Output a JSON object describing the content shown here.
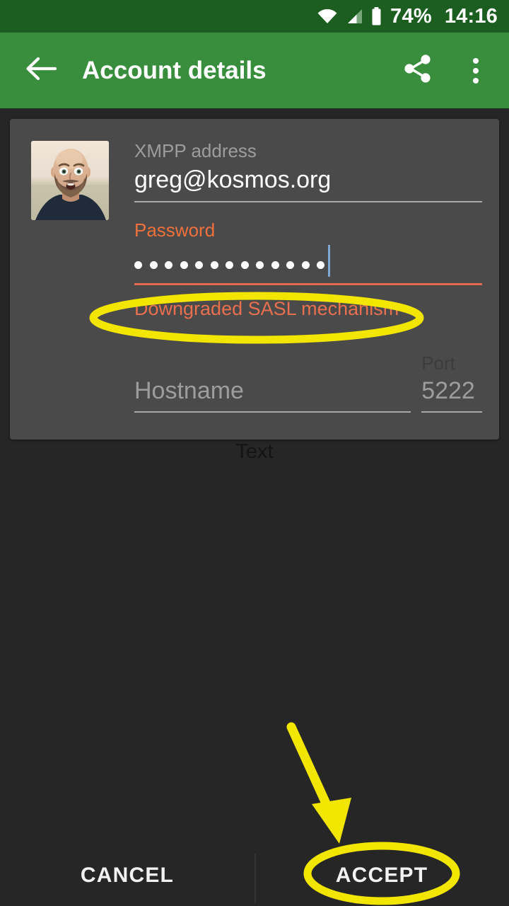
{
  "status_bar": {
    "wifi_icon": "wifi-icon",
    "signal_icon": "cell-signal-icon",
    "battery_icon": "battery-icon",
    "battery_percent": "74%",
    "time": "14:16",
    "background_color": "#1B5E20"
  },
  "toolbar": {
    "back_icon": "back-arrow-icon",
    "title": "Account details",
    "share_icon": "share-icon",
    "overflow_icon": "more-vertical-icon",
    "background_color": "#388E3C"
  },
  "card": {
    "avatar_alt": "user-avatar",
    "xmpp": {
      "label": "XMPP address",
      "value": "greg@kosmos.org",
      "placeholder": "XMPP address"
    },
    "password": {
      "label": "Password",
      "masked_value": "•••••••••••••",
      "dot_count": 13,
      "placeholder": "Password",
      "label_color": "#F0703C",
      "underline_color": "#E2684F",
      "error": "Downgraded SASL mechanism",
      "error_color": "#E8704F"
    },
    "hostname": {
      "label": "Hostname",
      "value": "",
      "placeholder": "Hostname"
    },
    "port": {
      "label": "Port",
      "value": "",
      "placeholder": "5222"
    },
    "background_color": "#4a4a4a"
  },
  "stray_label": {
    "text": "Text"
  },
  "buttons": {
    "cancel": "CANCEL",
    "accept": "ACCEPT"
  },
  "annotations": {
    "color": "#F2E500",
    "ellipse_error_target": "Downgraded SASL mechanism",
    "ellipse_accept_target": "ACCEPT",
    "arrow_points_to": "ACCEPT"
  }
}
